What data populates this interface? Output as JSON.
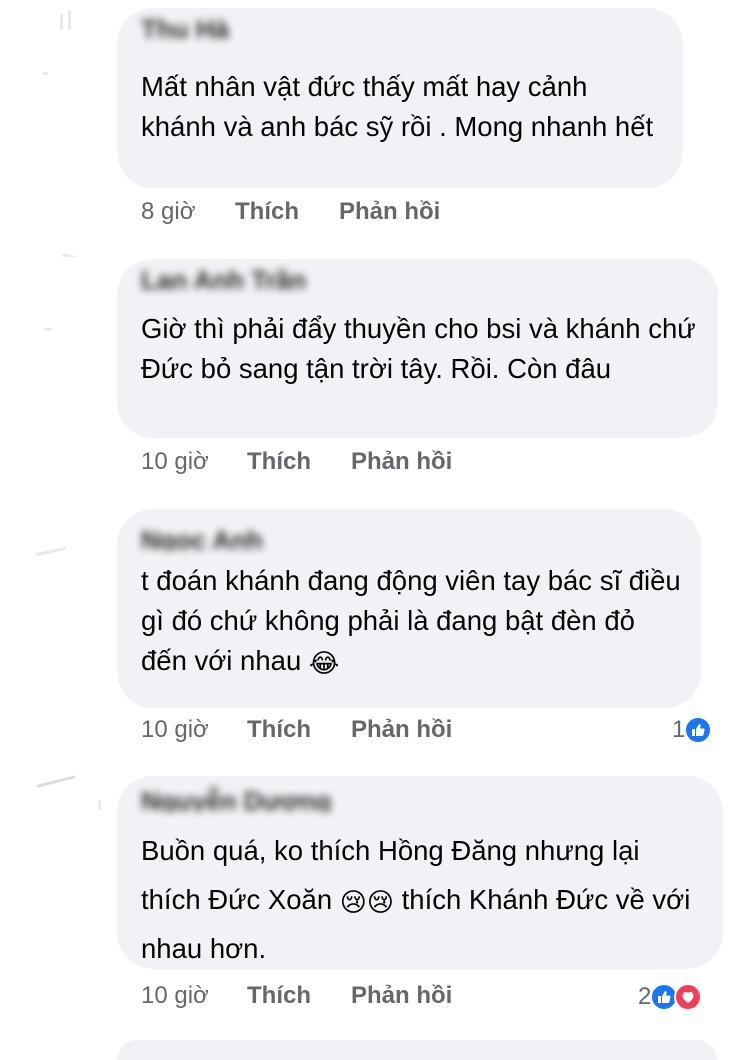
{
  "labels": {
    "like": "Thích",
    "reply": "Phản hồi"
  },
  "colors": {
    "bubble": "#f0f2f5",
    "meta": "#65676b",
    "like": "#1877f2",
    "love": "#f33e58"
  },
  "comments": [
    {
      "author": "Thu Hà",
      "text": "Mất nhân vật đức thấy mất hay cảnh khánh và anh bác sỹ rồi . Mong nhanh hết",
      "time": "8 giờ",
      "reactions": null
    },
    {
      "author": "Lan Anh Trần",
      "text": "Giờ thì phải đẩy thuyền cho bsi và khánh chứ Đức bỏ sang tận trời tây. Rồi. Còn đâu",
      "time": "10 giờ",
      "reactions": null
    },
    {
      "author": "Ngọc Anh",
      "text": "t đoán khánh đang động viên tay bác sĩ điều gì đó chứ không phải là đang bật đèn đỏ đến với nhau",
      "emoji": "😂",
      "time": "10 giờ",
      "reactions": {
        "count": "1",
        "types": [
          "like"
        ]
      }
    },
    {
      "author": "Nguyễn Dương",
      "text_a": "Buồn quá, ko  thích Hồng Đăng nhưng lại thích Đức Xoăn",
      "emoji": "😢😢",
      "text_b": "thích Khánh Đức về với nhau hơn.",
      "time": "10 giờ",
      "reactions": {
        "count": "2",
        "types": [
          "like",
          "love"
        ]
      }
    }
  ]
}
